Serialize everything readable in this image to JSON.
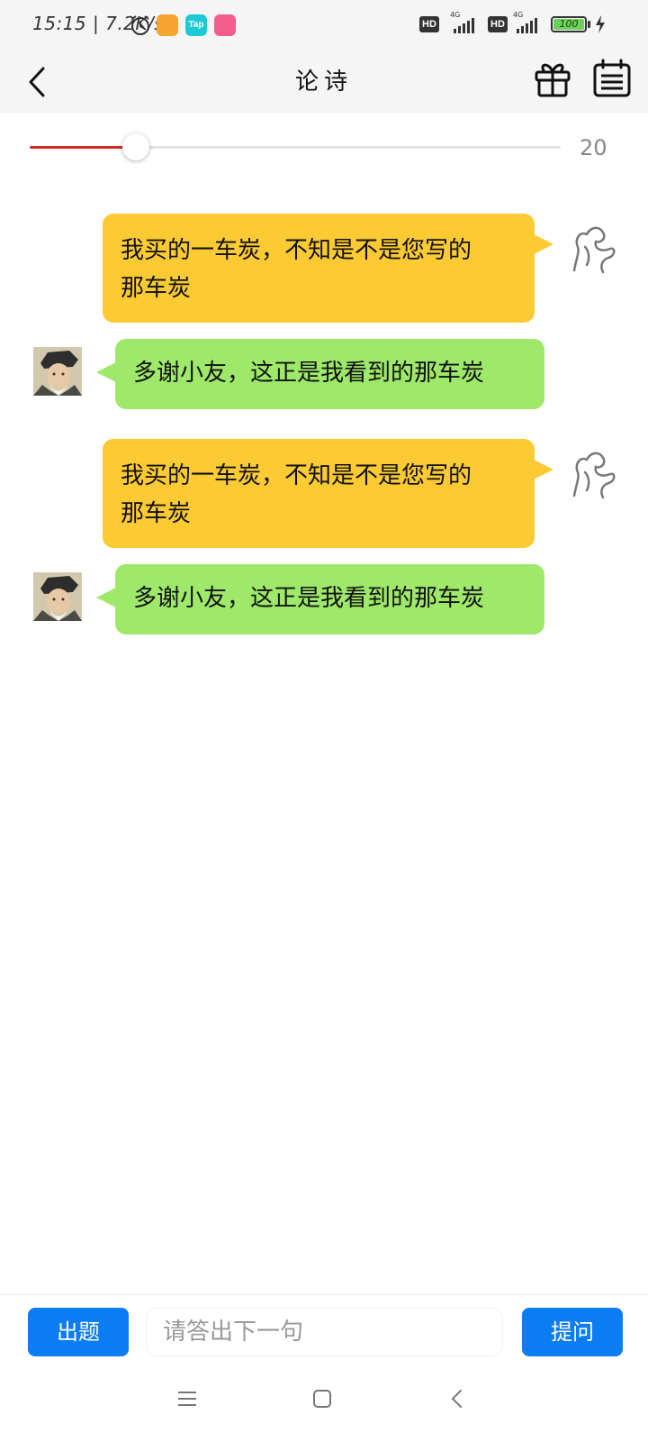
{
  "status": {
    "time_speed": "15:15 | 7.2K/s",
    "app_icon_tap_label": "Tap",
    "hd1": "HD",
    "net1": "4G",
    "hd2": "HD",
    "net2": "4G",
    "battery_level": "100"
  },
  "header": {
    "title": "论诗"
  },
  "slider": {
    "value": "20",
    "fill_fraction": 0.2
  },
  "messages": [
    {
      "role": "user",
      "text_line1": "我买的一车炭，不知是不是您写的",
      "text_line2": "那车炭"
    },
    {
      "role": "bot",
      "text": "多谢小友，这正是我看到的那车炭"
    },
    {
      "role": "user",
      "text_line1": "我买的一车炭，不知是不是您写的",
      "text_line2": "那车炭"
    },
    {
      "role": "bot",
      "text": "多谢小友，这正是我看到的那车炭"
    }
  ],
  "bottom": {
    "question_button": "出题",
    "answer_placeholder": "请答出下一句",
    "ask_button": "提问"
  },
  "colors": {
    "user_bubble": "#fcca33",
    "bot_bubble": "#9ee96a",
    "accent_blue": "#0b7cf2",
    "slider_red": "#d42a24"
  },
  "icons": {
    "back": "chevron-left-icon",
    "gift": "gift-icon",
    "menu": "list-menu-icon",
    "user_avatar": "sketch-avatar-icon",
    "bot_avatar": "poet-portrait-icon"
  }
}
